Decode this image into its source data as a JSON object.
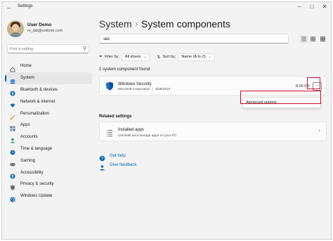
{
  "window": {
    "title": "Settings",
    "controls": {
      "minimize": "–",
      "maximize": "□",
      "close": "✕"
    },
    "back_glyph": "←"
  },
  "user": {
    "name": "User Demo",
    "email": "m_lab@outlook.com"
  },
  "sidebar": {
    "search_placeholder": "Find a setting",
    "items": [
      {
        "label": "Home",
        "icon": "home-icon",
        "color": "#5b5b5b"
      },
      {
        "label": "System",
        "icon": "laptop-icon",
        "color": "#0067c0",
        "active": true
      },
      {
        "label": "Bluetooth & devices",
        "icon": "bluetooth-icon",
        "color": "#0067c0"
      },
      {
        "label": "Network & internet",
        "icon": "wifi-icon",
        "color": "#0a6cbf"
      },
      {
        "label": "Personalization",
        "icon": "brush-icon",
        "color": "#d9812f"
      },
      {
        "label": "Apps",
        "icon": "apps-icon",
        "color": "#5c6a78"
      },
      {
        "label": "Accounts",
        "icon": "person-icon",
        "color": "#2a9d6b"
      },
      {
        "label": "Time & language",
        "icon": "globe-clock-icon",
        "color": "#0067c0"
      },
      {
        "label": "Gaming",
        "icon": "gamepad-icon",
        "color": "#5b5b5b"
      },
      {
        "label": "Accessibility",
        "icon": "accessibility-icon",
        "color": "#0a6cbf"
      },
      {
        "label": "Privacy & security",
        "icon": "shield-icon",
        "color": "#5b5b5b"
      },
      {
        "label": "Windows Update",
        "icon": "update-icon",
        "color": "#0067c0"
      }
    ]
  },
  "main": {
    "breadcrumb": {
      "parent": "System",
      "separator": "›",
      "current": "System components"
    },
    "search_value": "sec",
    "filter": {
      "label": "Filter by:",
      "value": "All drives"
    },
    "sort": {
      "label": "Sort by:",
      "value": "Name (A to Z)"
    },
    "result_count": "1 system component found",
    "component": {
      "name": "Windows Security",
      "publisher": "Microsoft Corporation",
      "date": "8/28/2024",
      "size": "8.00 KB",
      "more_glyph": "···"
    },
    "menu": {
      "item": "Advanced options"
    },
    "related_heading": "Related settings",
    "related": {
      "title": "Installed apps",
      "subtitle": "Uninstall and manage apps on your PC",
      "chevron": "›"
    },
    "links": {
      "help": "Get help",
      "feedback": "Give feedback"
    }
  },
  "colors": {
    "accent": "#005fb8",
    "highlight": "#c8102e",
    "background": "#f3f3f3"
  }
}
